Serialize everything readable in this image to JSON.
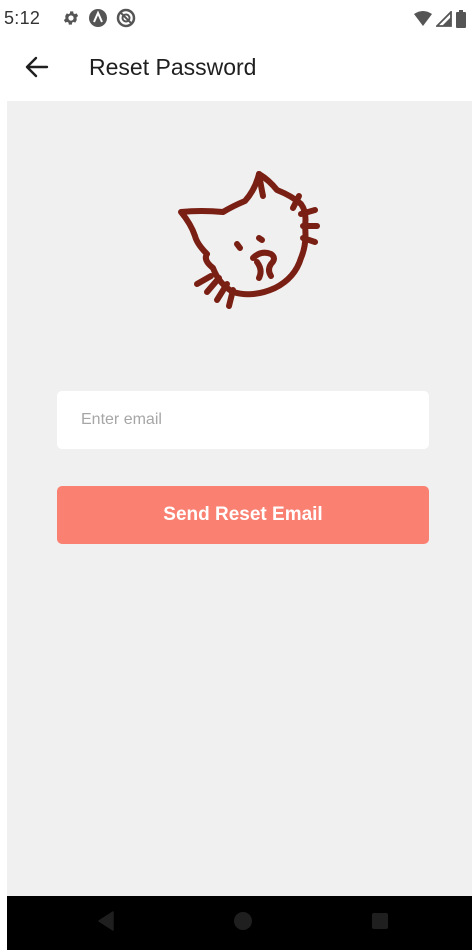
{
  "status_bar": {
    "time": "5:12",
    "left_icons": [
      "settings-icon",
      "autofill-a-icon",
      "data-saver-icon"
    ],
    "right_icons": [
      "wifi-icon",
      "signal-icon",
      "battery-icon"
    ]
  },
  "app_bar": {
    "title": "Reset Password",
    "back_icon": "arrow-left-icon"
  },
  "main": {
    "logo_icon": "cat-doodle-icon",
    "email_field": {
      "placeholder": "Enter email",
      "value": ""
    },
    "send_button_label": "Send Reset Email"
  },
  "nav_bar": {
    "buttons": [
      "back-triangle-icon",
      "home-circle-icon",
      "recents-square-icon"
    ]
  },
  "colors": {
    "accent": "#fa8072",
    "logo": "#7a1f13",
    "background": "#f1f0f0"
  }
}
